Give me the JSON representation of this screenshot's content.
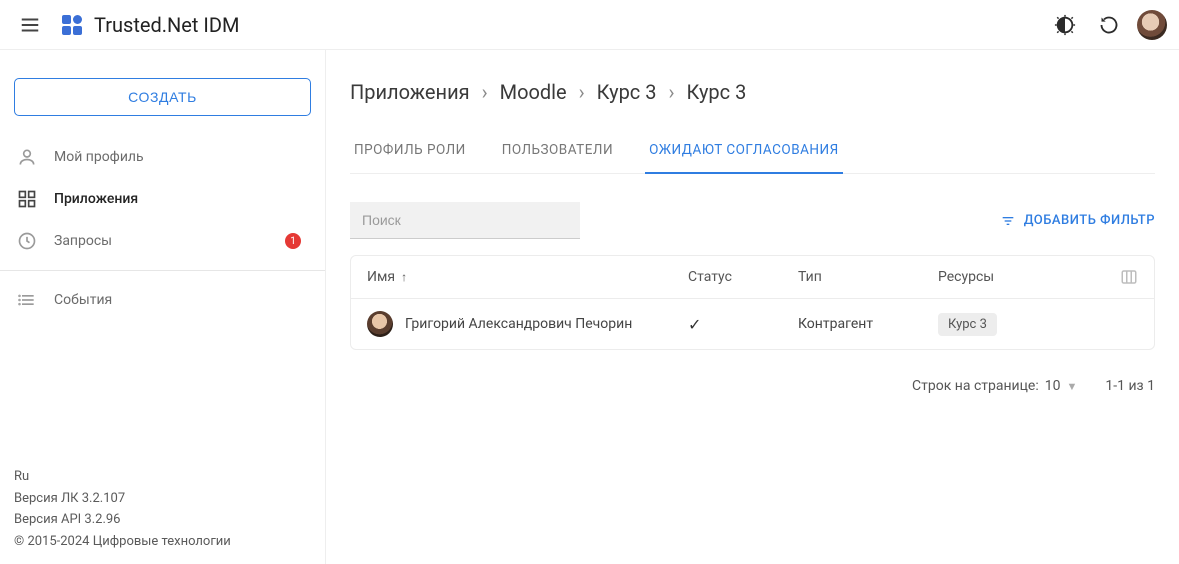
{
  "header": {
    "app_title": "Trusted.Net IDM"
  },
  "sidebar": {
    "create_label": "СОЗДАТЬ",
    "items": [
      {
        "label": "Мой профиль"
      },
      {
        "label": "Приложения"
      },
      {
        "label": "Запросы",
        "badge": "1"
      },
      {
        "label": "События"
      }
    ],
    "footer": {
      "lang": "Ru",
      "version_lk": "Версия ЛК 3.2.107",
      "version_api": "Версия API 3.2.96",
      "copyright": "© 2015-2024 Цифровые технологии"
    }
  },
  "breadcrumbs": [
    "Приложения",
    "Moodle",
    "Курс 3",
    "Курс 3"
  ],
  "tabs": [
    {
      "label": "ПРОФИЛЬ РОЛИ"
    },
    {
      "label": "ПОЛЬЗОВАТЕЛИ"
    },
    {
      "label": "ОЖИДАЮТ СОГЛАСОВАНИЯ"
    }
  ],
  "toolbar": {
    "search_placeholder": "Поиск",
    "add_filter_label": "ДОБАВИТЬ ФИЛЬТР"
  },
  "table": {
    "columns": {
      "name": "Имя",
      "status": "Статус",
      "type": "Тип",
      "resources": "Ресурсы"
    },
    "rows": [
      {
        "name": "Григорий Александрович Печорин",
        "status_icon": "check",
        "type": "Контрагент",
        "resource_chip": "Курс 3"
      }
    ]
  },
  "pager": {
    "rows_label": "Строк на странице:",
    "rows_value": "10",
    "range": "1-1 из 1"
  }
}
